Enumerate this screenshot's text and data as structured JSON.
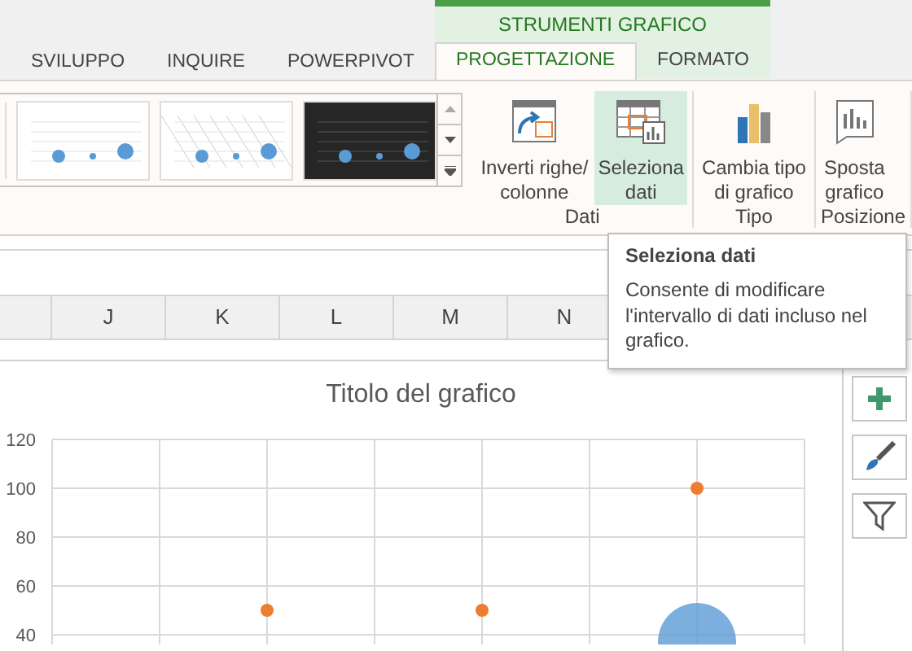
{
  "contextual_group": {
    "label": "STRUMENTI GRAFICO",
    "tabs": [
      {
        "label": "PROGETTAZIONE",
        "selected": true
      },
      {
        "label": "FORMATO",
        "selected": false
      }
    ]
  },
  "tabs": [
    {
      "label": "SVILUPPO",
      "selected": false
    },
    {
      "label": "INQUIRE",
      "selected": false
    },
    {
      "label": "POWERPIVOT",
      "selected": false
    }
  ],
  "gallery": [
    {
      "kind": "light"
    },
    {
      "kind": "hatched"
    },
    {
      "kind": "dark"
    }
  ],
  "groups": [
    {
      "label": "Dati",
      "buttons": [
        {
          "lines": [
            "Inverti righe/",
            "colonne"
          ],
          "hovered": false
        },
        {
          "lines": [
            "Seleziona",
            "dati"
          ],
          "hovered": true
        }
      ]
    },
    {
      "label": "Tipo",
      "buttons": [
        {
          "lines": [
            "Cambia tipo",
            "di grafico"
          ],
          "hovered": false
        }
      ]
    },
    {
      "label": "Posizione",
      "buttons": [
        {
          "lines": [
            "Sposta",
            "grafico"
          ],
          "hovered": false
        }
      ]
    }
  ],
  "columns": [
    "J",
    "K",
    "L",
    "M",
    "N"
  ],
  "chart": {
    "chart_data": {
      "type": "scatter",
      "title": "Titolo del grafico",
      "categories": [
        null,
        null,
        null,
        null,
        null,
        null,
        null,
        null
      ],
      "ylim": [
        36,
        120
      ],
      "grid": true,
      "yticks": [
        40,
        60,
        80,
        100,
        120
      ],
      "series": [
        {
          "color": "#ed7d31",
          "values": [
            null,
            null,
            50,
            null,
            50,
            null,
            100,
            null
          ]
        },
        {
          "color": "#5b9bd5",
          "values": [
            null,
            null,
            null,
            null,
            null,
            null,
            37,
            null
          ]
        }
      ]
    }
  },
  "tooltip": {
    "title": "Seleziona dati",
    "body": "Consente di modificare l'intervallo di dati incluso nel grafico."
  }
}
